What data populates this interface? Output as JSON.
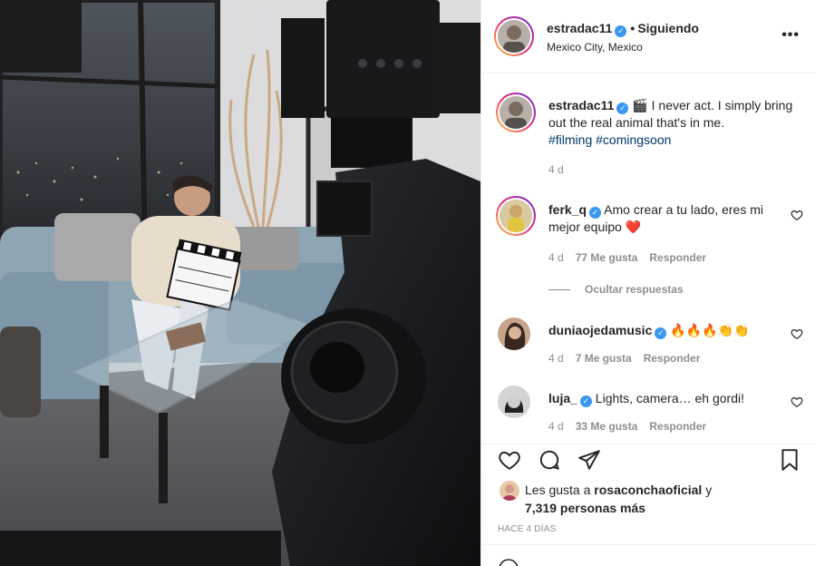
{
  "post": {
    "author": "estradac11",
    "verified_mark": "✓",
    "follow_separator": "•",
    "follow_status": "Siguiendo",
    "location": "Mexico City, Mexico",
    "more_icon": "more-options-icon"
  },
  "caption": {
    "username": "estradac11",
    "emoji": "🎬",
    "text": "I never act. I simply bring out the real animal that's in me.",
    "hashtags": [
      "#filming",
      "#comingsoon"
    ],
    "time": "4 d"
  },
  "comments": [
    {
      "username": "ferk_q",
      "text": "Amo crear a tu lado, eres mi mejor equipo",
      "emoji": "❤️",
      "time": "4 d",
      "likes": "77 Me gusta",
      "reply": "Responder"
    },
    {
      "username": "duniaojedamusic",
      "text": "",
      "emoji": "🔥🔥🔥👏👏",
      "time": "4 d",
      "likes": "7 Me gusta",
      "reply": "Responder"
    },
    {
      "username": "luja_",
      "text": "Lights, camera… eh gordi!",
      "emoji": "",
      "time": "4 d",
      "likes": "33 Me gusta",
      "reply": "Responder"
    }
  ],
  "hide_replies": "Ocultar respuestas",
  "actions": {
    "likes_prefix": "Les gusta a",
    "likes_user": "rosaconchaoficial",
    "likes_connector": "y",
    "likes_count": "7,319 personas más",
    "time_ago": "HACE 4 DÍAS"
  },
  "colors": {
    "link": "#00376b",
    "verified": "#3897f0",
    "muted": "#8e8e8e",
    "border": "#efefef"
  }
}
